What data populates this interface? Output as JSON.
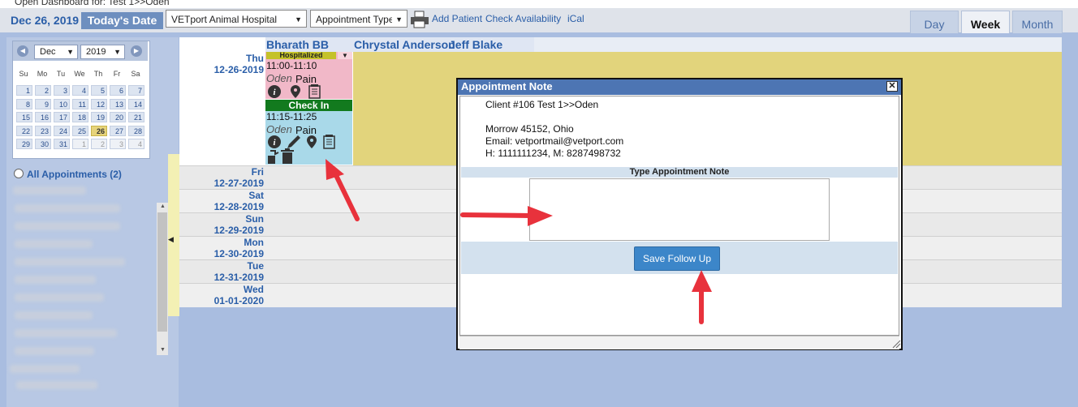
{
  "top_bar": {
    "text": "Open Dashboard for: Test 1>>Oden"
  },
  "toolbar": {
    "date": "Dec 26, 2019",
    "today_button": "Today's Date",
    "hospital_select": "VETport Animal Hospital",
    "type_select": "Appointment Type",
    "add_patient": "Add Patient",
    "check_availability": "Check Availability",
    "ical": "iCal"
  },
  "view_tabs": {
    "day": "Day",
    "week": "Week",
    "month": "Month",
    "active": "Week"
  },
  "mini_calendar": {
    "month": "Dec",
    "year": "2019",
    "dow": [
      "Su",
      "Mo",
      "Tu",
      "We",
      "Th",
      "Fr",
      "Sa"
    ],
    "weeks": [
      [
        "1",
        "2",
        "3",
        "4",
        "5",
        "6",
        "7"
      ],
      [
        "8",
        "9",
        "10",
        "11",
        "12",
        "13",
        "14"
      ],
      [
        "15",
        "16",
        "17",
        "18",
        "19",
        "20",
        "21"
      ],
      [
        "22",
        "23",
        "24",
        "25",
        "26",
        "27",
        "28"
      ],
      [
        "29",
        "30",
        "31",
        "1",
        "2",
        "3",
        "4"
      ]
    ],
    "selected": "26"
  },
  "sidebar": {
    "all_appointments": "All Appointments (2)"
  },
  "providers": [
    "Bharath BB",
    "Chrystal Anderson",
    "Jeff Blake"
  ],
  "days": [
    {
      "name": "Thu",
      "date": "12-26-2019"
    },
    {
      "name": "Fri",
      "date": "12-27-2019"
    },
    {
      "name": "Sat",
      "date": "12-28-2019"
    },
    {
      "name": "Sun",
      "date": "12-29-2019"
    },
    {
      "name": "Mon",
      "date": "12-30-2019"
    },
    {
      "name": "Tue",
      "date": "12-31-2019"
    },
    {
      "name": "Wed",
      "date": "01-01-2020"
    }
  ],
  "appointments": [
    {
      "status": "Hospitalized",
      "time": "11:00-11:10",
      "patient": "Oden",
      "reason": "Pain",
      "status_color": "#c4c22a"
    },
    {
      "status": "Check In",
      "time": "11:15-11:25",
      "patient": "Oden",
      "reason": "Pain",
      "status_color": "#127a1e"
    }
  ],
  "modal": {
    "title": "Appointment Note",
    "client_line": "Client #106 Test 1>>Oden",
    "address": "Morrow 45152, Ohio",
    "email": "Email: vetportmail@vetport.com",
    "phones": "H: 1111111234, M: 8287498732",
    "note_label": "Type Appointment Note",
    "note_value": "",
    "save_button": "Save Follow Up"
  },
  "colors": {
    "accent": "#2a5ea8",
    "modal_header": "#4d75b3",
    "save_button": "#3c86c9",
    "arrow": "#e8323c"
  }
}
